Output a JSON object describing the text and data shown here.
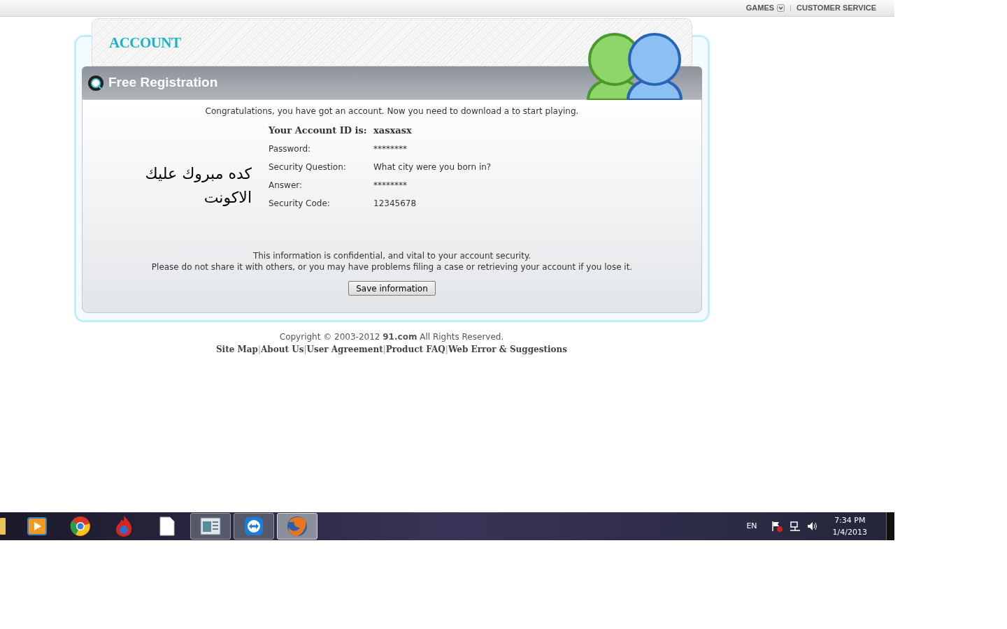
{
  "top_nav": {
    "items": [
      {
        "label": "GAMES",
        "kind": "dropdown"
      },
      {
        "label": "CUSTOMER SERVICE",
        "kind": "link"
      }
    ]
  },
  "header": {
    "title": "ACCOUNT",
    "panel_title": "Free Registration"
  },
  "intro": "Congratulations, you have got an account. Now you need to download a to start playing.",
  "fields": [
    {
      "label": "Your Account ID is:",
      "value": "xasxasx",
      "emphasis": true
    },
    {
      "label": "Password:",
      "value": "********",
      "emphasis": false
    },
    {
      "label": "Security Question:",
      "value": "What city were you born in?",
      "emphasis": false
    },
    {
      "label": "Answer:",
      "value": "********",
      "emphasis": false
    },
    {
      "label": "Security Code:",
      "value": "12345678",
      "emphasis": false
    }
  ],
  "annotation": "كده مبروك عليك الاكونت",
  "notice": [
    "This information is confidential, and vital to your account security.",
    "Please do not share it with others, or you may have problems filing a case or retrieving your account if you lose it."
  ],
  "save_button": "Save information",
  "footer": {
    "copyright": "Copyright © 2003-2012 **91.com** All Rights Reserved.",
    "links": [
      "Site Map",
      "About Us",
      "User Agreement",
      "Product FAQ",
      "Web Error & Suggestions"
    ],
    "separator": "|"
  },
  "taskbar": {
    "items": [
      {
        "kind": "folder",
        "open": false,
        "selected": false
      },
      {
        "kind": "media",
        "open": false,
        "selected": false
      },
      {
        "kind": "browser-ring",
        "open": false,
        "selected": false
      },
      {
        "kind": "flame",
        "open": false,
        "selected": false
      },
      {
        "kind": "document",
        "open": false,
        "selected": false
      },
      {
        "kind": "window",
        "open": true,
        "selected": false
      },
      {
        "kind": "remote",
        "open": true,
        "selected": false
      },
      {
        "kind": "globe",
        "open": true,
        "selected": true
      }
    ],
    "language": "EN",
    "time": "7:34 PM",
    "date": "1/4/2013"
  }
}
